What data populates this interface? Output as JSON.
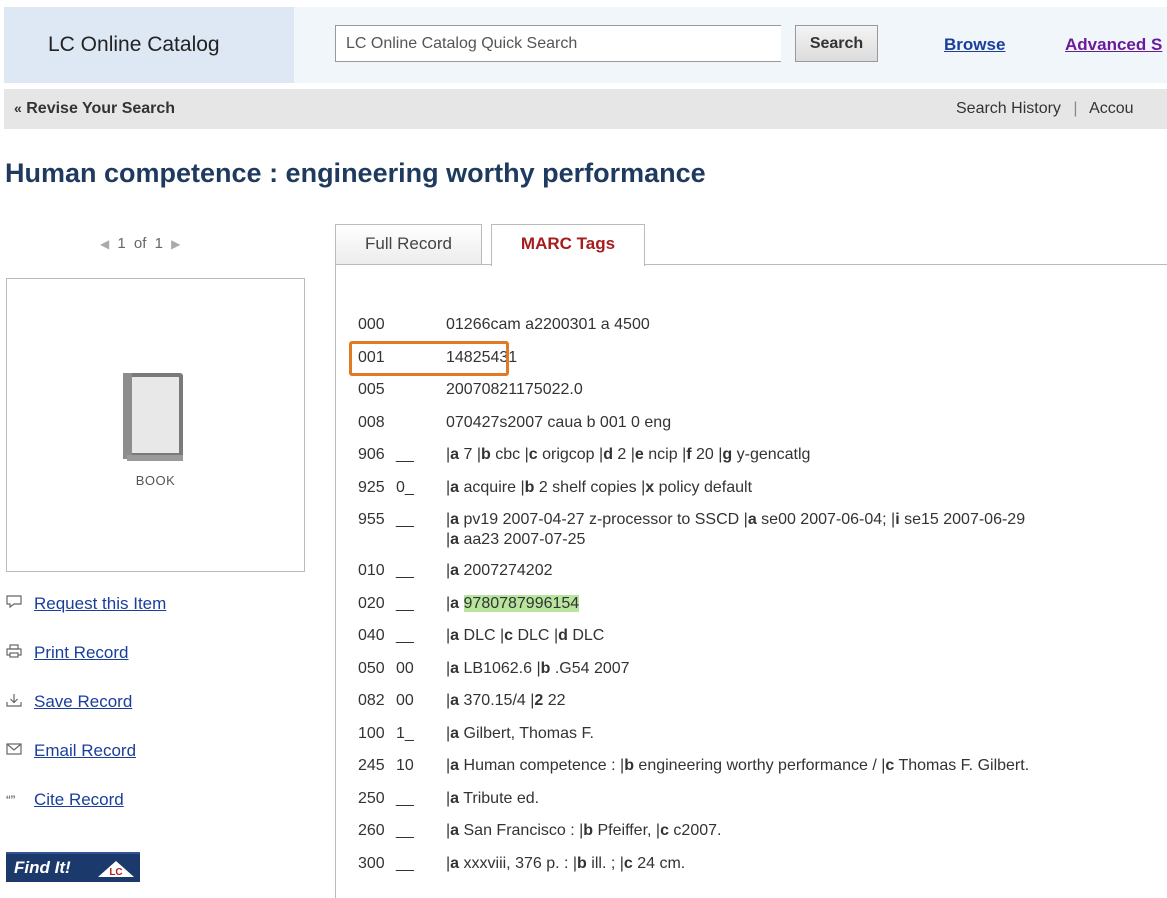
{
  "header": {
    "brand": "LC Online Catalog",
    "search_placeholder": "LC Online Catalog Quick Search",
    "search_button": "Search",
    "nav_browse": "Browse",
    "nav_advanced": "Advanced S"
  },
  "subbar": {
    "revise_prefix": "«",
    "revise_label": "Revise Your Search",
    "search_history": "Search History",
    "separator": "|",
    "account": "Accou"
  },
  "title": "Human competence : engineering worthy performance",
  "pager": {
    "prev": "◀",
    "current": "1",
    "of": "of",
    "total": "1",
    "next": "▶"
  },
  "cover": {
    "label": "BOOK"
  },
  "actions": [
    {
      "icon": "comment-icon",
      "glyph": "🗩",
      "label": "Request this Item"
    },
    {
      "icon": "print-icon",
      "glyph": "🖨",
      "label": "Print Record"
    },
    {
      "icon": "download-icon",
      "glyph": "⤓",
      "label": "Save Record"
    },
    {
      "icon": "email-icon",
      "glyph": "✉",
      "label": "Email Record"
    },
    {
      "icon": "quote-icon",
      "glyph": "“”",
      "label": "Cite Record"
    }
  ],
  "find_it": {
    "label": "Find It!",
    "logo_text": "LC"
  },
  "tabs": [
    {
      "label": "Full Record",
      "active": false
    },
    {
      "label": "MARC Tags",
      "active": true
    }
  ],
  "colors": {
    "isbn_highlight": "#b7e59d",
    "callout_border": "#e07a24",
    "active_tab": "#a61d1d"
  },
  "marc": [
    {
      "tag": "000",
      "ind": "",
      "data": "01266cam a2200301 a 4500"
    },
    {
      "tag": "001",
      "ind": "",
      "data": "14825431",
      "boxed": true
    },
    {
      "tag": "005",
      "ind": "",
      "data": "20070821175022.0"
    },
    {
      "tag": "008",
      "ind": "",
      "data": "070427s2007 caua b 001 0 eng"
    },
    {
      "tag": "906",
      "ind": "__",
      "data": "|a 7 |b cbc |c origcop |d 2 |e ncip |f 20 |g y-gencatlg"
    },
    {
      "tag": "925",
      "ind": "0_",
      "data": "|a acquire |b 2 shelf copies |x policy default"
    },
    {
      "tag": "955",
      "ind": "__",
      "data": "|a pv19 2007-04-27 z-processor to SSCD |a se00 2007-06-04; |i se15 2007-06-29",
      "data2": "|a aa23 2007-07-25"
    },
    {
      "tag": "010",
      "ind": "__",
      "data": "|a 2007274202"
    },
    {
      "tag": "020",
      "ind": "__",
      "data": "|a 9780787996154",
      "highlight": true
    },
    {
      "tag": "040",
      "ind": "__",
      "data": "|a DLC |c DLC |d DLC"
    },
    {
      "tag": "050",
      "ind": "00",
      "data": "|a LB1062.6 |b .G54 2007"
    },
    {
      "tag": "082",
      "ind": "00",
      "data": "|a 370.15/4 |2 22"
    },
    {
      "tag": "100",
      "ind": "1_",
      "data": "|a Gilbert, Thomas F."
    },
    {
      "tag": "245",
      "ind": "10",
      "data": "|a Human competence : |b engineering worthy performance / |c Thomas F. Gilbert."
    },
    {
      "tag": "250",
      "ind": "__",
      "data": "|a Tribute ed."
    },
    {
      "tag": "260",
      "ind": "__",
      "data": "|a San Francisco : |b Pfeiffer, |c c2007."
    },
    {
      "tag": "300",
      "ind": "__",
      "data": "|a xxxviii, 376 p. : |b ill. ; |c 24 cm."
    }
  ]
}
